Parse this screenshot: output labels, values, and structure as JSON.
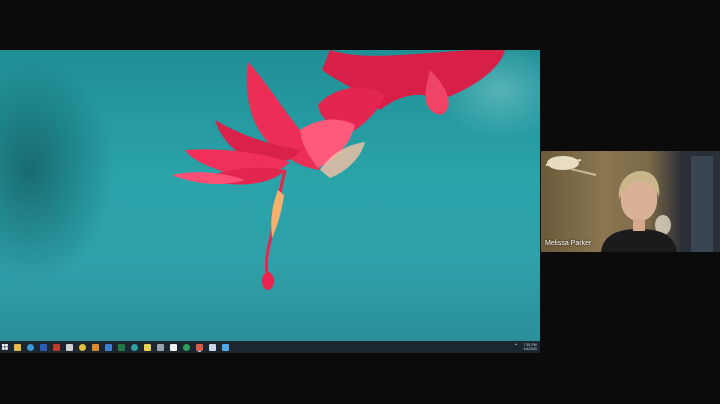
{
  "window": {
    "title": ""
  },
  "taskbar": {
    "icons": [
      {
        "name": "file-explorer-icon",
        "color": "#e8b84a"
      },
      {
        "name": "edge-icon",
        "color": "#3a9ad9"
      },
      {
        "name": "word-icon",
        "color": "#2b5bb5"
      },
      {
        "name": "app-red-icon",
        "color": "#c0392b"
      },
      {
        "name": "settings-icon",
        "color": "#d0d0d0"
      },
      {
        "name": "chrome-icon",
        "color": "#e0c040"
      },
      {
        "name": "app-orange-icon",
        "color": "#e08a2a"
      },
      {
        "name": "app-blue-icon",
        "color": "#3d7fd1"
      },
      {
        "name": "excel-icon",
        "color": "#1e7b45"
      },
      {
        "name": "app-teal-icon",
        "color": "#29a3a0"
      },
      {
        "name": "notes-icon",
        "color": "#e8d050"
      },
      {
        "name": "app-gray-icon",
        "color": "#9aa4ad"
      },
      {
        "name": "app-white-icon",
        "color": "#f0f0f0"
      },
      {
        "name": "app-green-icon",
        "color": "#2fa05a"
      },
      {
        "name": "zoom-icon",
        "color": "#d65b4a"
      },
      {
        "name": "cloud-icon",
        "color": "#c8d6e4"
      },
      {
        "name": "app-lightblue-icon",
        "color": "#4fa8e8"
      }
    ],
    "tray": {
      "time": "7:51 PM",
      "date": "1/4/2020"
    }
  },
  "participant": {
    "name": "Melissa Parker"
  },
  "colors": {
    "accent": "#8ac4ff",
    "flower": "#e8244f"
  }
}
